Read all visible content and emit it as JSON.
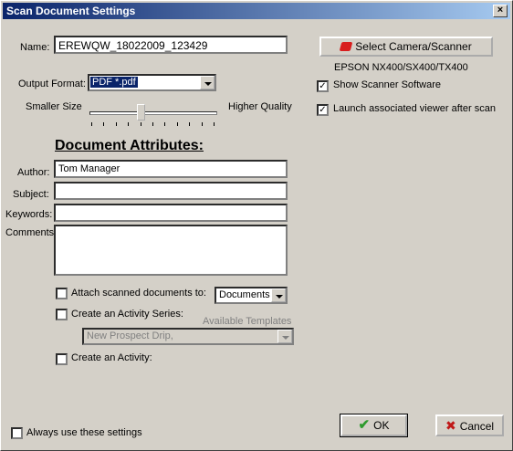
{
  "window": {
    "title": "Scan Document Settings",
    "close_glyph": "×"
  },
  "form": {
    "name_label": "Name:",
    "name_value": "EREWQW_18022009_123429",
    "output_format_label": "Output Format:",
    "output_format_value": "PDF *.pdf",
    "smaller_size_label": "Smaller Size",
    "higher_quality_label": "Higher Quality",
    "quality_slider_level": 0.4,
    "section_heading": "Document Attributes:",
    "author_label": "Author:",
    "author_value": "Tom Manager",
    "subject_label": "Subject:",
    "subject_value": "",
    "keywords_label": "Keywords:",
    "keywords_value": "",
    "comments_label": "Comments:",
    "comments_value": ""
  },
  "scanner": {
    "select_button_label": "Select Camera/Scanner",
    "device_name": "EPSON NX400/SX400/TX400",
    "show_software_label": "Show Scanner Software",
    "show_software_checked": true,
    "launch_viewer_label": "Launch associated viewer after scan",
    "launch_viewer_checked": true
  },
  "options": {
    "attach_label": "Attach scanned documents to:",
    "attach_checked": false,
    "attach_value": "Documents",
    "activity_series_label": "Create an Activity Series:",
    "activity_series_checked": false,
    "available_templates_label": "Available Templates",
    "template_value": "New Prospect Drip,",
    "create_activity_label": "Create an Activity:",
    "create_activity_checked": false,
    "always_use_label": "Always use these settings",
    "always_use_checked": false
  },
  "buttons": {
    "ok_label": "OK",
    "cancel_label": "Cancel"
  },
  "icons": {
    "check": "✔",
    "cancel_x": "✖",
    "checkbox_mark": "✓"
  },
  "colors": {
    "ok_green": "#2e9b2e",
    "cancel_red": "#c01818",
    "titlebar": "#0a246a"
  }
}
